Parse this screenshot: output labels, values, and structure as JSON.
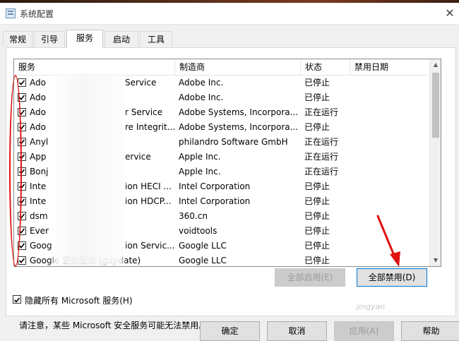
{
  "window": {
    "title": "系统配置",
    "close_glyph": "✕"
  },
  "tabs": [
    {
      "label": "常规",
      "active": false
    },
    {
      "label": "引导",
      "active": false
    },
    {
      "label": "服务",
      "active": true
    },
    {
      "label": "启动",
      "active": false
    },
    {
      "label": "工具",
      "active": false
    }
  ],
  "columns": [
    "服务",
    "制造商",
    "状态",
    "禁用日期"
  ],
  "rows": [
    {
      "checked": true,
      "name_start": "Ado",
      "name_end": "Service",
      "manufacturer": "Adobe Inc.",
      "status": "已停止"
    },
    {
      "checked": true,
      "name_start": "Ado",
      "name_end": "",
      "manufacturer": "Adobe Inc.",
      "status": "已停止"
    },
    {
      "checked": true,
      "name_start": "Ado",
      "name_end": "r Service",
      "manufacturer": "Adobe Systems, Incorpora...",
      "status": "正在运行"
    },
    {
      "checked": true,
      "name_start": "Ado",
      "name_end": "re Integrit...",
      "manufacturer": "Adobe Systems, Incorpora...",
      "status": "已停止"
    },
    {
      "checked": true,
      "name_start": "Anyl",
      "name_end": "",
      "manufacturer": "philandro Software GmbH",
      "status": "正在运行"
    },
    {
      "checked": true,
      "name_start": "App",
      "name_end": "ervice",
      "manufacturer": "Apple Inc.",
      "status": "正在运行"
    },
    {
      "checked": true,
      "name_start": "Bonj",
      "name_end": "",
      "manufacturer": "Apple Inc.",
      "status": "正在运行"
    },
    {
      "checked": true,
      "name_start": "Inte",
      "name_end": "ion HECI ...",
      "manufacturer": "Intel Corporation",
      "status": "已停止"
    },
    {
      "checked": true,
      "name_start": "Inte",
      "name_end": "ion HDCP...",
      "manufacturer": "Intel Corporation",
      "status": "已停止"
    },
    {
      "checked": true,
      "name_start": "dsm",
      "name_end": "",
      "manufacturer": "360.cn",
      "status": "已停止"
    },
    {
      "checked": true,
      "name_start": "Ever",
      "name_end": "",
      "manufacturer": "voidtools",
      "status": "已停止"
    },
    {
      "checked": true,
      "name_start": "Goog",
      "name_end": "ion Servic...",
      "manufacturer": "Google LLC",
      "status": "已停止"
    },
    {
      "checked": true,
      "name_start": "Google 更新服务 (gupdate)",
      "name_end": "",
      "manufacturer": "Google LLC",
      "status": "已停止"
    }
  ],
  "note": "请注意，某些 Microsoft 安全服务可能无法禁用。",
  "buttons": {
    "enable_all": "全部启用(E)",
    "disable_all": "全部禁用(D)",
    "ok": "确定",
    "cancel": "取消",
    "apply": "应用(A)",
    "help": "帮助"
  },
  "hide_ms": {
    "label": "隐藏所有 Microsoft 服务(H)",
    "checked": true
  },
  "watermark": "jingyan",
  "colors": {
    "annotation_red": "#e01010",
    "focus_blue": "#0078d7"
  }
}
